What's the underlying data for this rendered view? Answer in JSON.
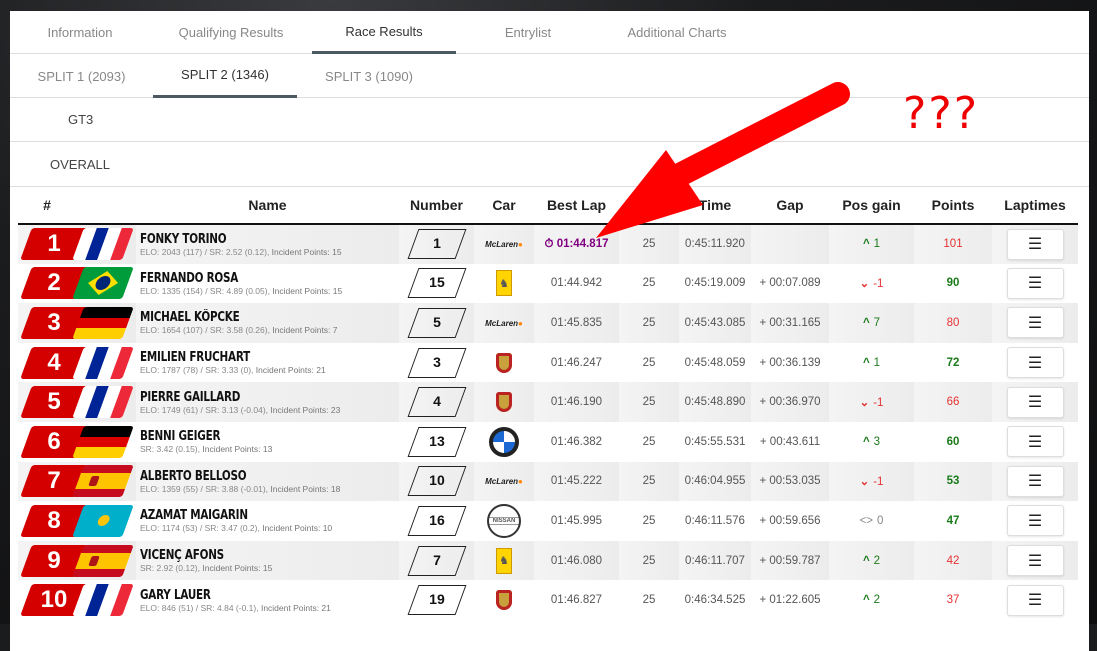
{
  "tabs": [
    "Information",
    "Qualifying Results",
    "Race Results",
    "Entrylist",
    "Additional Charts"
  ],
  "splits": [
    "SPLIT 1 (2093)",
    "SPLIT 2 (1346)",
    "SPLIT 3 (1090)"
  ],
  "class_label": "GT3",
  "overall_label": "OVERALL",
  "annotation": "???",
  "headers": {
    "pos": "#",
    "name": "Name",
    "number": "Number",
    "car": "Car",
    "best": "Best Lap",
    "laps": "",
    "time": "Time",
    "gap": "Gap",
    "posgain": "Pos gain",
    "points": "Points",
    "laptimes": "Laptimes"
  },
  "rows": [
    {
      "pos": "1",
      "flag": "fr",
      "name": "FONKY TORINO",
      "elo": "ELO: 2043 (117) / SR: 2.52 (0.12), ",
      "ip": "Incident Points: 15",
      "number": "1",
      "car": "mclaren",
      "best": "01:44.817",
      "laps": "25",
      "time": "0:45:11.920",
      "gap": "",
      "dir": "up",
      "gain": "1",
      "points": "101",
      "pc": "r"
    },
    {
      "pos": "2",
      "flag": "br",
      "name": "FERNANDO ROSA",
      "elo": "ELO: 1335 (154) / SR: 4.89 (0.05), ",
      "ip": "Incident Points: 15",
      "number": "15",
      "car": "ferrari",
      "best": "01:44.942",
      "laps": "25",
      "time": "0:45:19.009",
      "gap": "+ 00:07.089",
      "dir": "dn",
      "gain": "-1",
      "points": "90",
      "pc": "g"
    },
    {
      "pos": "3",
      "flag": "de",
      "name": "MICHAEL KÖPCKE",
      "elo": "ELO: 1654 (107) / SR: 3.58 (0.26), ",
      "ip": "Incident Points: 7",
      "number": "5",
      "car": "mclaren",
      "best": "01:45.835",
      "laps": "25",
      "time": "0:45:43.085",
      "gap": "+ 00:31.165",
      "dir": "up",
      "gain": "7",
      "points": "80",
      "pc": "r"
    },
    {
      "pos": "4",
      "flag": "fr",
      "name": "EMILIEN FRUCHART",
      "elo": "ELO: 1787 (78) / SR: 3.33 (0), ",
      "ip": "Incident Points: 21",
      "number": "3",
      "car": "porsche",
      "best": "01:46.247",
      "laps": "25",
      "time": "0:45:48.059",
      "gap": "+ 00:36.139",
      "dir": "up",
      "gain": "1",
      "points": "72",
      "pc": "g"
    },
    {
      "pos": "5",
      "flag": "fr",
      "name": "PIERRE GAILLARD",
      "elo": "ELO: 1749 (61) / SR: 3.13 (-0.04), ",
      "ip": "Incident Points: 23",
      "number": "4",
      "car": "porsche",
      "best": "01:46.190",
      "laps": "25",
      "time": "0:45:48.890",
      "gap": "+ 00:36.970",
      "dir": "dn",
      "gain": "-1",
      "points": "66",
      "pc": "r"
    },
    {
      "pos": "6",
      "flag": "de",
      "name": "BENNI GEIGER",
      "elo": "SR: 3.42 (0.15), ",
      "ip": "Incident Points: 13",
      "number": "13",
      "car": "bmw",
      "best": "01:46.382",
      "laps": "25",
      "time": "0:45:55.531",
      "gap": "+ 00:43.611",
      "dir": "up",
      "gain": "3",
      "points": "60",
      "pc": "g"
    },
    {
      "pos": "7",
      "flag": "es",
      "name": "ALBERTO BELLOSO",
      "elo": "ELO: 1359 (55) / SR: 3.88 (-0.01), ",
      "ip": "Incident Points: 18",
      "number": "10",
      "car": "mclaren",
      "best": "01:45.222",
      "laps": "25",
      "time": "0:46:04.955",
      "gap": "+ 00:53.035",
      "dir": "dn",
      "gain": "-1",
      "points": "53",
      "pc": "g"
    },
    {
      "pos": "8",
      "flag": "kz",
      "name": "AZAMAT MAIGARIN",
      "elo": "ELO: 1174 (53) / SR: 3.47 (0.2), ",
      "ip": "Incident Points: 10",
      "number": "16",
      "car": "nissan",
      "best": "01:45.995",
      "laps": "25",
      "time": "0:46:11.576",
      "gap": "+ 00:59.656",
      "dir": "eq",
      "gain": "0",
      "points": "47",
      "pc": "g"
    },
    {
      "pos": "9",
      "flag": "es",
      "name": "VICENÇ AFONS",
      "elo": "SR: 2.92 (0.12), ",
      "ip": "Incident Points: 15",
      "number": "7",
      "car": "ferrari",
      "best": "01:46.080",
      "laps": "25",
      "time": "0:46:11.707",
      "gap": "+ 00:59.787",
      "dir": "up",
      "gain": "2",
      "points": "42",
      "pc": "r"
    },
    {
      "pos": "10",
      "flag": "fr",
      "name": "GARY LAUER",
      "elo": "ELO: 846 (51) / SR: 4.84 (-0.1), ",
      "ip": "Incident Points: 21",
      "number": "19",
      "car": "porsche",
      "best": "01:46.827",
      "laps": "25",
      "time": "0:46:34.525",
      "gap": "+ 01:22.605",
      "dir": "up",
      "gain": "2",
      "points": "37",
      "pc": "r"
    }
  ],
  "car_logo_text": {
    "mclaren": "McLaren",
    "nissan": "NISSAN"
  },
  "colors": {
    "accent": "#d40000",
    "best_lap": "#800080",
    "up": "#1a7a1a",
    "down": "#e53333"
  }
}
